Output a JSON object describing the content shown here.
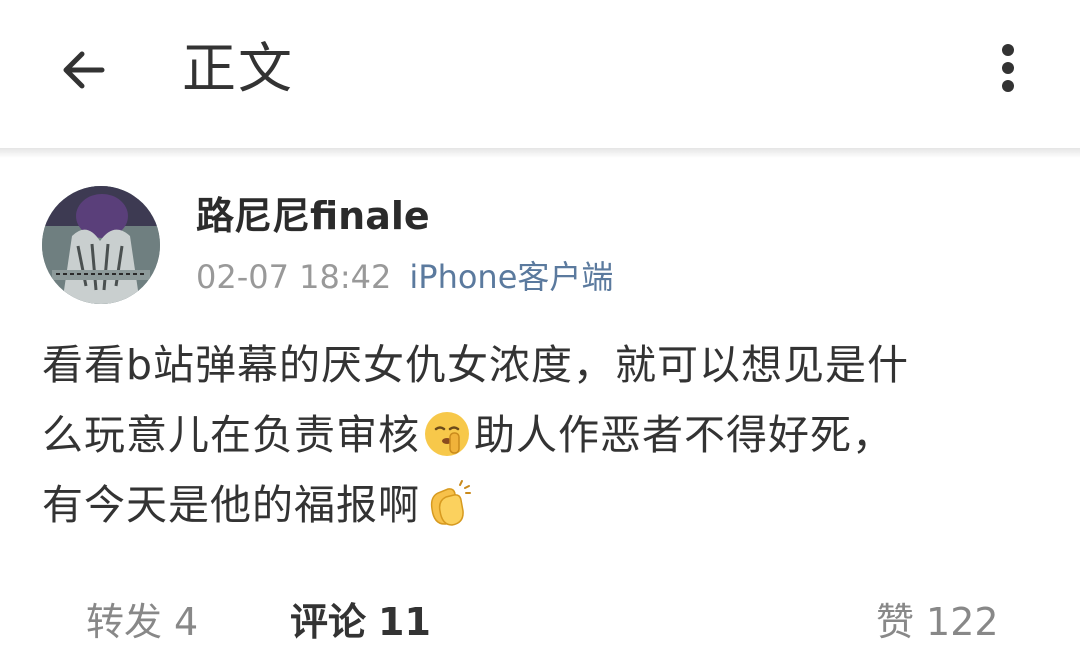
{
  "header": {
    "back_icon": "back-arrow-icon",
    "title": "正文",
    "more_icon": "more-vertical-icon"
  },
  "post": {
    "author": {
      "name": "路尼尼finale",
      "avatar": "avatar-image"
    },
    "time": "02-07 18:42",
    "source": "iPhone客户端",
    "content": {
      "line1": "看看b站弹幕的厌女仇女浓度，就可以想见是什",
      "line2a": "么玩意儿在负责审核",
      "emoji1": "shushing-face-emoji",
      "line2b": "助人作恶者不得好死，",
      "line3": "有今天是他的福报啊",
      "emoji2": "clapping-hands-emoji"
    }
  },
  "actions": {
    "repost": {
      "label": "转发",
      "count": "4"
    },
    "comment": {
      "label": "评论",
      "count": "11"
    },
    "like": {
      "label": "赞",
      "count": "122"
    }
  }
}
